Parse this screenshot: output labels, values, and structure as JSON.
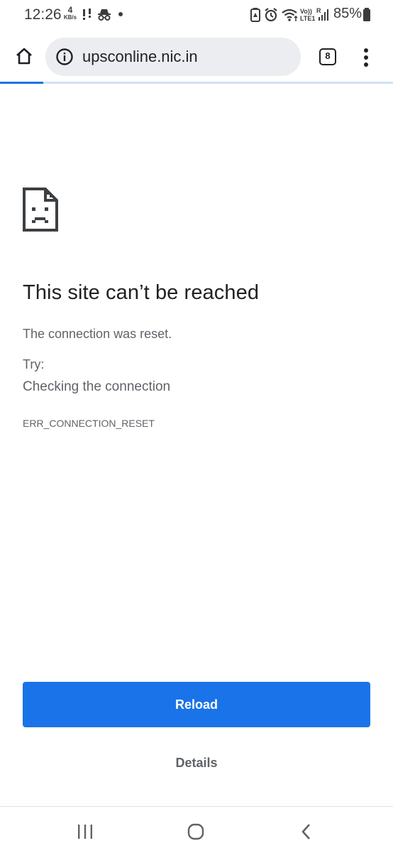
{
  "status_bar": {
    "time": "12:26",
    "net_speed_value": "4",
    "net_speed_unit": "KB/s",
    "network_label": "Vo)) LTE1",
    "roaming_label": "R",
    "battery_percent": "85%",
    "icons": [
      "signal-dots-icon",
      "incognito-icon",
      "battery-saver-icon",
      "alarm-icon",
      "wifi-icon",
      "signal-bars-icon",
      "battery-icon"
    ]
  },
  "toolbar": {
    "url": "upsconline.nic.in",
    "tab_count": "8",
    "icons": [
      "home-icon",
      "info-icon",
      "overflow-menu-icon"
    ]
  },
  "page_load_progress": 0.11,
  "error_page": {
    "title": "This site can’t be reached",
    "description": "The connection was reset.",
    "try_label": "Try:",
    "suggestion": "Checking the connection",
    "error_code": "ERR_CONNECTION_RESET",
    "reload_label": "Reload",
    "details_label": "Details"
  },
  "nav_bar": {
    "icons": [
      "recent-apps-icon",
      "home-circle-icon",
      "back-icon"
    ]
  },
  "colors": {
    "accent": "#1a73e8",
    "omnibox_bg": "#ebedf1",
    "secondary_text": "#5f6368"
  }
}
